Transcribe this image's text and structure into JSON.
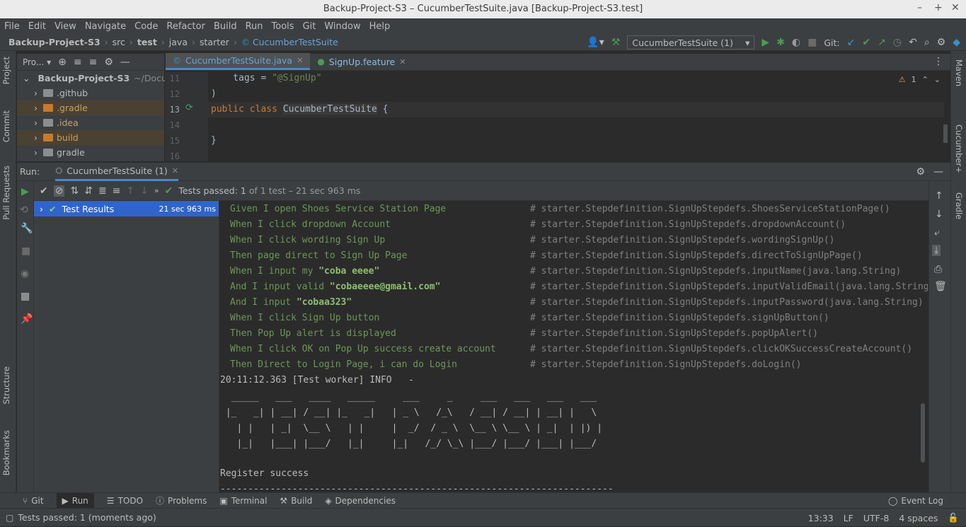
{
  "window": {
    "title": "Backup-Project-S3 – CucumberTestSuite.java [Backup-Project-S3.test]",
    "controls": [
      "–",
      "+",
      "✕"
    ]
  },
  "menu": [
    "File",
    "Edit",
    "View",
    "Navigate",
    "Code",
    "Refactor",
    "Build",
    "Run",
    "Tools",
    "Git",
    "Window",
    "Help"
  ],
  "breadcrumb": [
    "Backup-Project-S3",
    "src",
    "test",
    "java",
    "starter",
    "CucumberTestSuite"
  ],
  "toolbar": {
    "run_config": "CucumberTestSuite (1)",
    "git_label": "Git:"
  },
  "left_tabs": [
    "Project",
    "Commit",
    "Pull Requests",
    "Structure",
    "Bookmarks"
  ],
  "right_tabs": [
    "Maven",
    "Cucumber+",
    "Gradle"
  ],
  "project": {
    "header": "Pro...",
    "root": "Backup-Project-S3",
    "root_path": "~/Docum",
    "items": [
      ".github",
      ".gradle",
      ".idea",
      "build",
      "gradle"
    ]
  },
  "editor": {
    "tabs": [
      "CucumberTestSuite.java",
      "SignUp.feature"
    ],
    "warning_count": "1",
    "lines": [
      {
        "num": "11",
        "text": "    tags = \"@SignUp\""
      },
      {
        "num": "12",
        "text": ")"
      },
      {
        "num": "13",
        "text": "public class CucumberTestSuite {"
      },
      {
        "num": "14",
        "text": ""
      },
      {
        "num": "15",
        "text": "}"
      },
      {
        "num": "16",
        "text": ""
      }
    ],
    "line11_prefix": "    tags = ",
    "line11_string": "\"@SignUp\"",
    "line13_kw": "public class ",
    "line13_cls": "CucumberTestSuite",
    "line13_rest": " {"
  },
  "run": {
    "label": "Run:",
    "tab": "CucumberTestSuite (1)",
    "status_prefix": "Tests passed:",
    "status_count": "1",
    "status_rest": "of 1 test – 21 sec 963 ms",
    "tree_root": "Test Results",
    "tree_time": "21 sec 963 ms"
  },
  "console": {
    "steps": [
      {
        "keyword": "Given",
        "text": " I open Shoes Service Station Page",
        "bold": "",
        "after": "",
        "comment": "# starter.Stepdefinition.SignUpStepdefs.ShoesServiceStationPage()"
      },
      {
        "keyword": "When",
        "text": " I click dropdown Account",
        "bold": "",
        "after": "",
        "comment": "# starter.Stepdefinition.SignUpStepdefs.dropdownAccount()"
      },
      {
        "keyword": "When",
        "text": " I click wording Sign Up",
        "bold": "",
        "after": "",
        "comment": "# starter.Stepdefinition.SignUpStepdefs.wordingSignUp()"
      },
      {
        "keyword": "Then",
        "text": " page direct to Sign Up Page",
        "bold": "",
        "after": "",
        "comment": "# starter.Stepdefinition.SignUpStepdefs.directToSignUpPage()"
      },
      {
        "keyword": "When",
        "text": " I input my ",
        "bold": "\"coba eeee\"",
        "after": "",
        "comment": "# starter.Stepdefinition.SignUpStepdefs.inputName(java.lang.String)"
      },
      {
        "keyword": "And",
        "text": " I input valid ",
        "bold": "\"cobaeeee@gmail.com\"",
        "after": "",
        "comment": "# starter.Stepdefinition.SignUpStepdefs.inputValidEmail(java.lang.String)"
      },
      {
        "keyword": "And",
        "text": " I input ",
        "bold": "\"cobaa323\"",
        "after": "",
        "comment": "# starter.Stepdefinition.SignUpStepdefs.inputPassword(java.lang.String)"
      },
      {
        "keyword": "When",
        "text": " I click Sign Up button",
        "bold": "",
        "after": "",
        "comment": "# starter.Stepdefinition.SignUpStepdefs.signUpButton()"
      },
      {
        "keyword": "Then",
        "text": " Pop Up alert is displayed",
        "bold": "",
        "after": "",
        "comment": "# starter.Stepdefinition.SignUpStepdefs.popUpAlert()"
      },
      {
        "keyword": "When",
        "text": " I click OK on Pop Up success create account",
        "bold": "",
        "after": "",
        "comment": "# starter.Stepdefinition.SignUpStepdefs.clickOKSuccessCreateAccount()"
      },
      {
        "keyword": "Then",
        "text": " Direct to Login Page, i can do Login",
        "bold": "",
        "after": "",
        "comment": "# starter.Stepdefinition.SignUpStepdefs.doLogin()"
      }
    ],
    "log_line": "20:11:12.363 [Test worker] INFO   -",
    "ascii": [
      "  _____   ___   ____   _____     ___     _     ___   ___   ___   ___",
      " |_   _| | __| / __| |_   _|   | _ \\   /_\\   / __| / __| | __| |   \\",
      "   | |   | _|  \\__ \\   | |     |  _/  / _ \\  \\__ \\ \\__ \\ | _|  | |) |",
      "   |_|   |___| |___/   |_|     |_|   /_/ \\_\\ |___/ |___/ |___| |___/"
    ],
    "register_line": "Register success",
    "dash_line": "-----------------------------------------------------------------------"
  },
  "bottom_tabs": [
    "Git",
    "Run",
    "TODO",
    "Problems",
    "Terminal",
    "Build",
    "Dependencies"
  ],
  "event_log": "Event Log",
  "status": {
    "message": "Tests passed: 1 (moments ago)",
    "position": "13:33",
    "line_sep": "LF",
    "encoding": "UTF-8",
    "indent": "4 spaces"
  }
}
